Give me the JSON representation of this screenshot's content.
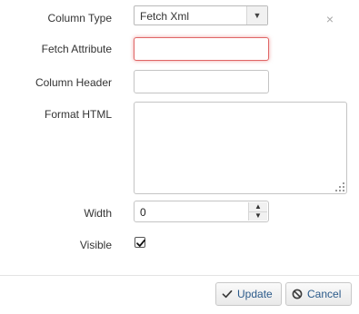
{
  "form": {
    "column_type": {
      "label": "Column Type",
      "value": "Fetch Xml"
    },
    "fetch_attribute": {
      "label": "Fetch Attribute",
      "value": ""
    },
    "column_header": {
      "label": "Column Header",
      "value": ""
    },
    "format_html": {
      "label": "Format HTML",
      "value": ""
    },
    "width": {
      "label": "Width",
      "value": "0"
    },
    "visible": {
      "label": "Visible",
      "checked": true
    }
  },
  "close_icon": "close-icon",
  "buttons": {
    "update": {
      "label": "Update",
      "icon": "check-icon"
    },
    "cancel": {
      "label": "Cancel",
      "icon": "cancel-circle-icon"
    }
  }
}
